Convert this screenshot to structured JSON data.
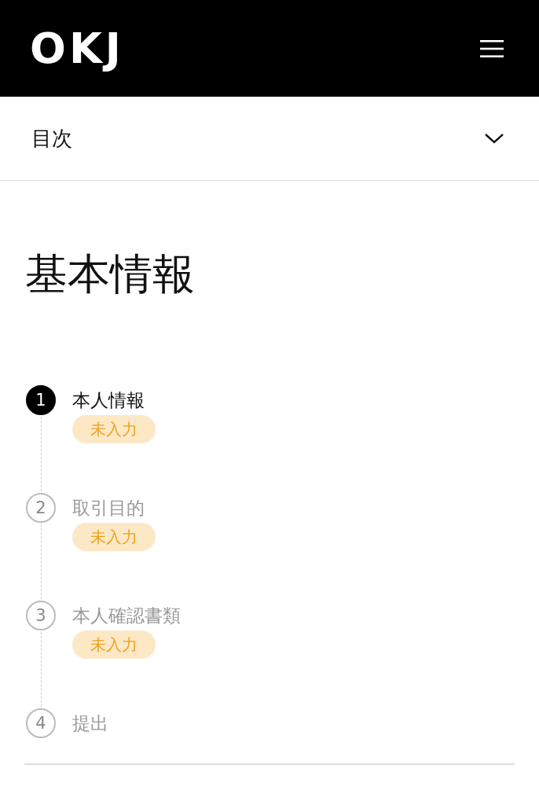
{
  "header": {
    "logo": "OKJ"
  },
  "toc": {
    "label": "目次",
    "expanded": false
  },
  "title": "基本情報",
  "steps": [
    {
      "number": "1",
      "label": "本人情報",
      "active": true,
      "badge": "未入力"
    },
    {
      "number": "2",
      "label": "取引目的",
      "active": false,
      "badge": "未入力"
    },
    {
      "number": "3",
      "label": "本人確認書類",
      "active": false,
      "badge": "未入力"
    },
    {
      "number": "4",
      "label": "提出",
      "active": false
    }
  ]
}
